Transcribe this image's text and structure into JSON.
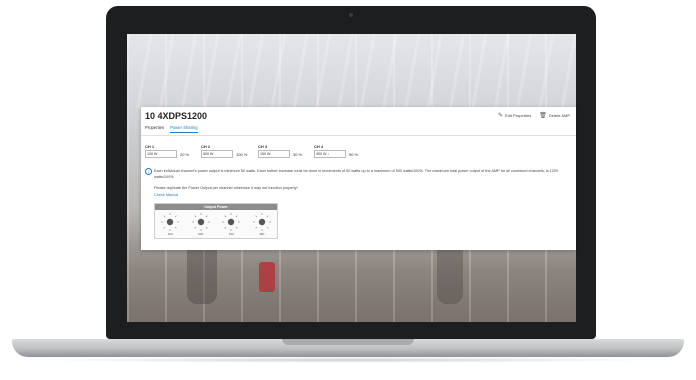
{
  "app": {
    "title": "10 4XDPS1200",
    "actions": {
      "edit": "Edit Properties",
      "delete": "Delete AMP"
    },
    "tabs": [
      {
        "label": "Properties",
        "active": false
      },
      {
        "label": "Power Sharing",
        "active": true
      }
    ]
  },
  "channels": [
    {
      "label": "CH 1",
      "value": "100 W",
      "percent": "20 %"
    },
    {
      "label": "CH 2",
      "value": "500 W",
      "percent": "100 %"
    },
    {
      "label": "CH 3",
      "value": "150 W",
      "percent": "30 %"
    },
    {
      "label": "CH 4",
      "value": "450 W",
      "percent": "90 %"
    }
  ],
  "info": {
    "text": "Each individual channel's power output is minimum 50 watts. Each further increase must be done in increments of 50 watts up to a maximum of 500 watts/100%. The maximum total power output of the AMP for all combined channels, is 1200 watts/100%",
    "notice": "Please replicate the Power Output per channel otherwise it may not function properly!",
    "link": "Check Manual"
  },
  "output_power": {
    "title": "Output Power",
    "values": [
      "100",
      "500",
      "150",
      "450"
    ]
  },
  "colors": {
    "accent": "#2a7ab8",
    "header_gray": "#8d8d8d"
  }
}
